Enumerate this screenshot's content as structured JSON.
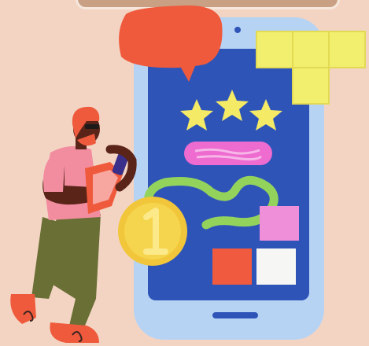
{
  "illustration": {
    "phone": {
      "screen_color": "#2f54b8",
      "frame_color": "#b6d3f4"
    },
    "rating": {
      "stars": 3,
      "star_color": "#f4ea66"
    },
    "medal": {
      "digit": "1",
      "color": "#f1c63a"
    },
    "speech_bubble": {
      "color": "#ef5a3c"
    },
    "blocks": {
      "color": "#f2ee6e"
    },
    "person": {
      "shirt_color": "#f28da0",
      "pants_color": "#6a6f35",
      "hair_color": "#ef5a3c"
    }
  }
}
